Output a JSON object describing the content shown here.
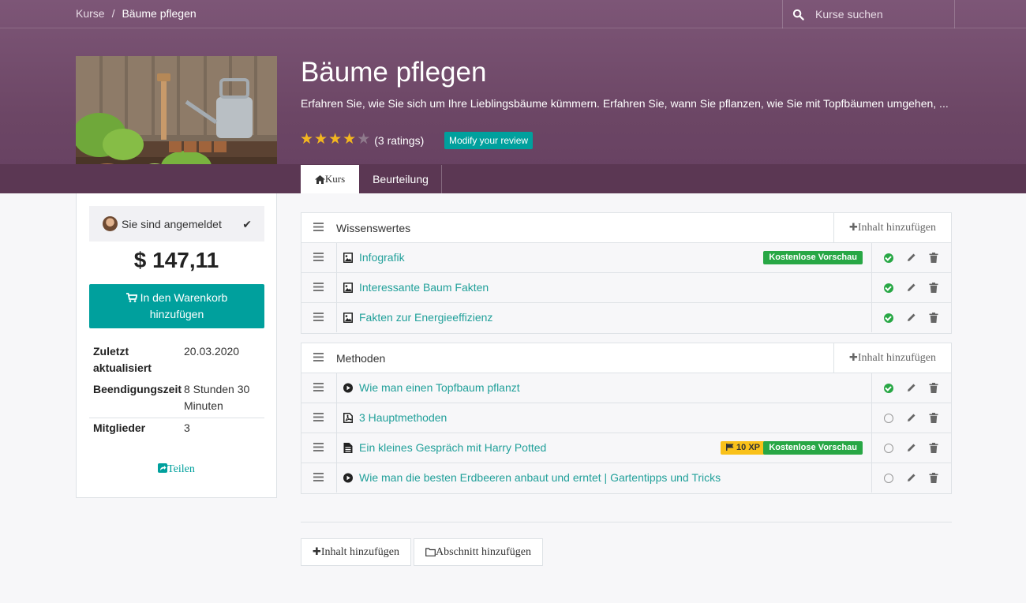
{
  "breadcrumb": {
    "root": "Kurse",
    "separator": "/",
    "current": "Bäume pflegen"
  },
  "search": {
    "placeholder": "Kurse suchen"
  },
  "course": {
    "title": "Bäume pflegen",
    "description": "Erfahren Sie, wie Sie sich um Ihre Lieblingsbäume kümmern. Erfahren Sie, wann Sie pflanzen, wie Sie mit Topfbäumen umgehen, ...",
    "rating_stars": 4,
    "rating_max": 5,
    "ratings_label": "(3 ratings)",
    "review_button": "Modify your review"
  },
  "tabs": {
    "course": "Kurs",
    "review": "Beurteilung"
  },
  "sidebar": {
    "enrolled_label": "Sie sind angemeldet",
    "price": "$ 147,11",
    "cart_button_line1": "In den Warenkorb",
    "cart_button_line2": "hinzufügen",
    "info": [
      {
        "key": "Zuletzt aktualisiert",
        "value": "20.03.2020"
      },
      {
        "key": "Beendigungszeit",
        "value": "8 Stunden 30 Minuten"
      },
      {
        "key": "Mitglieder",
        "value": "3"
      }
    ],
    "share": "Teilen"
  },
  "sections": [
    {
      "title": "Wissenswertes",
      "add_content": "Inhalt hinzufügen",
      "items": [
        {
          "title": "Infografik",
          "type": "image",
          "badges": [
            "Kostenlose Vorschau"
          ],
          "done": true
        },
        {
          "title": "Interessante Baum Fakten",
          "type": "image",
          "badges": [],
          "done": true
        },
        {
          "title": "Fakten zur Energieeffizienz",
          "type": "image",
          "badges": [],
          "done": true
        }
      ]
    },
    {
      "title": "Methoden",
      "add_content": "Inhalt hinzufügen",
      "items": [
        {
          "title": "Wie man einen Topfbaum pflanzt",
          "type": "video",
          "badges": [],
          "done": true
        },
        {
          "title": "3 Hauptmethoden",
          "type": "pdf",
          "badges": [],
          "done": false
        },
        {
          "title": "Ein kleines Gespräch mit Harry Potted",
          "type": "document",
          "xp": "10 XP",
          "badges": [
            "Kostenlose Vorschau"
          ],
          "done": false
        },
        {
          "title": "Wie man die besten Erdbeeren anbaut und erntet | Gartentipps und Tricks",
          "type": "video",
          "badges": [],
          "done": false
        }
      ]
    }
  ],
  "footer_buttons": {
    "add_content": "Inhalt hinzufügen",
    "add_section": "Abschnitt hinzufügen"
  },
  "colors": {
    "header": "#7d5677",
    "tabband": "#5b3753",
    "accent": "#00a09d",
    "link": "#21a09a",
    "success": "#28a745",
    "xp": "#f9c11a"
  }
}
